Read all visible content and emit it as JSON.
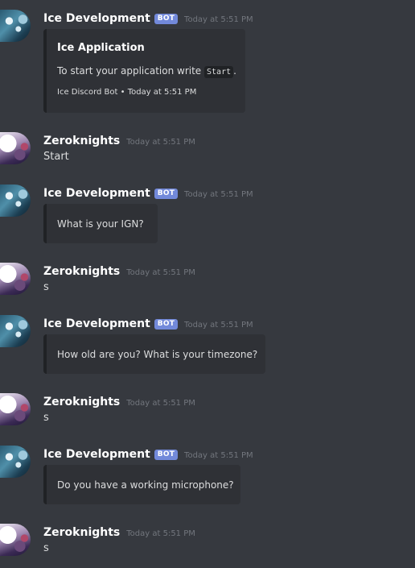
{
  "messages": [
    {
      "author": "Ice Development",
      "bot_tag": "BOT",
      "timestamp": "Today at 5:51 PM",
      "embed": {
        "title": "Ice Application",
        "description_prefix": "To start your application write",
        "code": "Start",
        "description_suffix": ".",
        "footer": "Ice Discord Bot • Today at 5:51 PM"
      }
    },
    {
      "author": "Zeroknights",
      "timestamp": "Today at 5:51 PM",
      "text": "Start"
    },
    {
      "author": "Ice Development",
      "bot_tag": "BOT",
      "timestamp": "Today at 5:51 PM",
      "embed_text": "What is your IGN?"
    },
    {
      "author": "Zeroknights",
      "timestamp": "Today at 5:51 PM",
      "text": "s"
    },
    {
      "author": "Ice Development",
      "bot_tag": "BOT",
      "timestamp": "Today at 5:51 PM",
      "embed_text": "How old are you? What is your timezone?"
    },
    {
      "author": "Zeroknights",
      "timestamp": "Today at 5:51 PM",
      "text": "s"
    },
    {
      "author": "Ice Development",
      "bot_tag": "BOT",
      "timestamp": "Today at 5:51 PM",
      "embed_text": "Do you have a working microphone?"
    },
    {
      "author": "Zeroknights",
      "timestamp": "Today at 5:51 PM",
      "text": "s"
    }
  ],
  "colors": {
    "background": "#36393f",
    "embed_background": "#2f3136",
    "bot_tag": "#7289da",
    "timestamp": "#72767d",
    "username": "#ffffff",
    "message_text": "#dcddde"
  },
  "icons": {
    "bot_avatar": "ice-development-avatar-icon",
    "user_avatar": "zeroknights-avatar-icon"
  }
}
